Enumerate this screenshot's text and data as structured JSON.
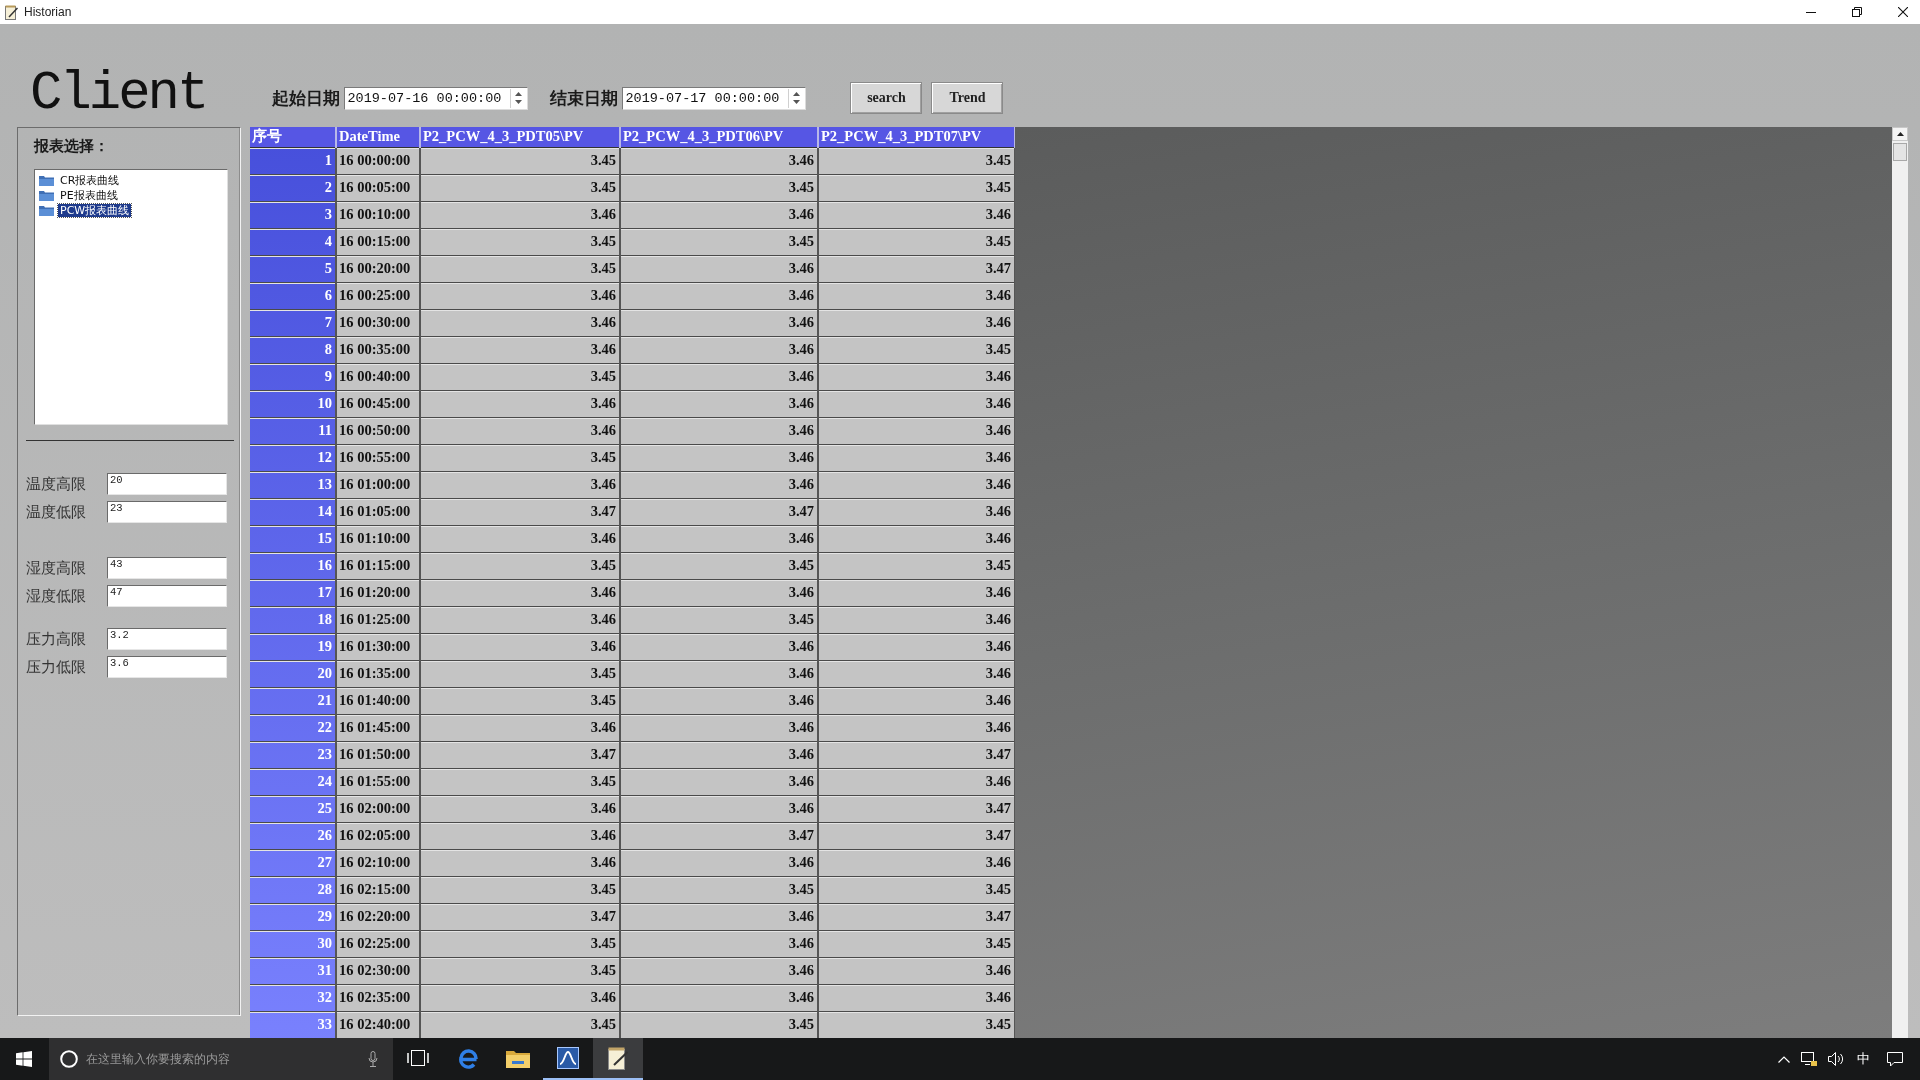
{
  "window": {
    "title": "Historian"
  },
  "header": {
    "app_name": "Client",
    "start_date": {
      "label": "起始日期",
      "value": "2019-07-16 00:00:00"
    },
    "end_date": {
      "label": "结束日期",
      "value": "2019-07-17 00:00:00"
    },
    "buttons": [
      "search",
      "Trend"
    ]
  },
  "sidebar": {
    "report_select": {
      "label": "报表选择：",
      "items": [
        {
          "label": "CR报表曲线",
          "selected": false
        },
        {
          "label": "PE报表曲线",
          "selected": false
        },
        {
          "label": "PCW报表曲线",
          "selected": true
        }
      ]
    },
    "limit_groups": [
      [
        {
          "label": "温度高限",
          "value": "20"
        },
        {
          "label": "温度低限",
          "value": "23"
        }
      ],
      [
        {
          "label": "湿度高限",
          "value": "43"
        },
        {
          "label": "湿度低限",
          "value": "47"
        }
      ],
      [
        {
          "label": "压力高限",
          "value": "3.2"
        },
        {
          "label": "压力低限",
          "value": "3.6"
        }
      ]
    ]
  },
  "table": {
    "columns": [
      "序号",
      "DateTime",
      "P2_PCW_4_3_PDT05\\PV",
      "P2_PCW_4_3_PDT06\\PV",
      "P2_PCW_4_3_PDT07\\PV"
    ],
    "rows": [
      [
        "1",
        "16 00:00:00",
        "3.45",
        "3.46",
        "3.45"
      ],
      [
        "2",
        "16 00:05:00",
        "3.45",
        "3.45",
        "3.45"
      ],
      [
        "3",
        "16 00:10:00",
        "3.46",
        "3.46",
        "3.46"
      ],
      [
        "4",
        "16 00:15:00",
        "3.45",
        "3.45",
        "3.45"
      ],
      [
        "5",
        "16 00:20:00",
        "3.45",
        "3.46",
        "3.47"
      ],
      [
        "6",
        "16 00:25:00",
        "3.46",
        "3.46",
        "3.46"
      ],
      [
        "7",
        "16 00:30:00",
        "3.46",
        "3.46",
        "3.46"
      ],
      [
        "8",
        "16 00:35:00",
        "3.46",
        "3.46",
        "3.45"
      ],
      [
        "9",
        "16 00:40:00",
        "3.45",
        "3.46",
        "3.46"
      ],
      [
        "10",
        "16 00:45:00",
        "3.46",
        "3.46",
        "3.46"
      ],
      [
        "11",
        "16 00:50:00",
        "3.46",
        "3.46",
        "3.46"
      ],
      [
        "12",
        "16 00:55:00",
        "3.45",
        "3.46",
        "3.46"
      ],
      [
        "13",
        "16 01:00:00",
        "3.46",
        "3.46",
        "3.46"
      ],
      [
        "14",
        "16 01:05:00",
        "3.47",
        "3.47",
        "3.46"
      ],
      [
        "15",
        "16 01:10:00",
        "3.46",
        "3.46",
        "3.46"
      ],
      [
        "16",
        "16 01:15:00",
        "3.45",
        "3.45",
        "3.45"
      ],
      [
        "17",
        "16 01:20:00",
        "3.46",
        "3.46",
        "3.46"
      ],
      [
        "18",
        "16 01:25:00",
        "3.46",
        "3.45",
        "3.46"
      ],
      [
        "19",
        "16 01:30:00",
        "3.46",
        "3.46",
        "3.46"
      ],
      [
        "20",
        "16 01:35:00",
        "3.45",
        "3.46",
        "3.46"
      ],
      [
        "21",
        "16 01:40:00",
        "3.45",
        "3.46",
        "3.46"
      ],
      [
        "22",
        "16 01:45:00",
        "3.46",
        "3.46",
        "3.46"
      ],
      [
        "23",
        "16 01:50:00",
        "3.47",
        "3.46",
        "3.47"
      ],
      [
        "24",
        "16 01:55:00",
        "3.45",
        "3.46",
        "3.46"
      ],
      [
        "25",
        "16 02:00:00",
        "3.46",
        "3.46",
        "3.47"
      ],
      [
        "26",
        "16 02:05:00",
        "3.46",
        "3.47",
        "3.47"
      ],
      [
        "27",
        "16 02:10:00",
        "3.46",
        "3.46",
        "3.46"
      ],
      [
        "28",
        "16 02:15:00",
        "3.45",
        "3.45",
        "3.45"
      ],
      [
        "29",
        "16 02:20:00",
        "3.47",
        "3.46",
        "3.47"
      ],
      [
        "30",
        "16 02:25:00",
        "3.45",
        "3.46",
        "3.45"
      ],
      [
        "31",
        "16 02:30:00",
        "3.45",
        "3.46",
        "3.46"
      ],
      [
        "32",
        "16 02:35:00",
        "3.46",
        "3.46",
        "3.46"
      ],
      [
        "33",
        "16 02:40:00",
        "3.45",
        "3.45",
        "3.45"
      ]
    ]
  },
  "taskbar": {
    "search": {
      "placeholder": "在这里输入你要搜索的内容"
    },
    "apps": [
      {
        "kind": "task-view",
        "running": false,
        "selected": false
      },
      {
        "kind": "browser",
        "running": false,
        "selected": false
      },
      {
        "kind": "folder",
        "running": false,
        "selected": false
      },
      {
        "kind": "chart",
        "running": true,
        "selected": false
      },
      {
        "kind": "notepad",
        "running": true,
        "selected": true
      }
    ],
    "tray": {
      "ime": "中"
    }
  }
}
